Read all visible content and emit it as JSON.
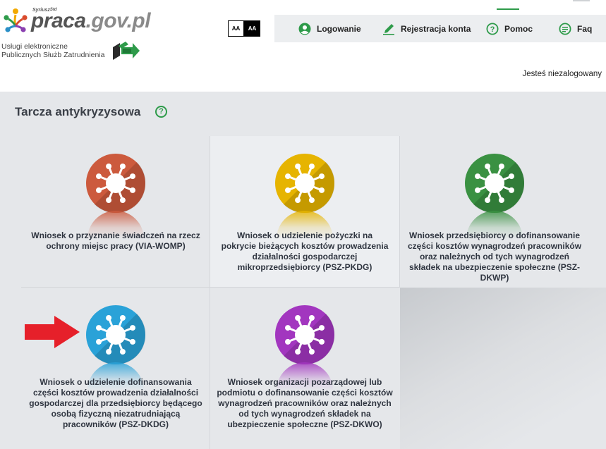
{
  "header": {
    "logo_main": "praca",
    "logo_domain": ".gov.pl",
    "logo_small": "Syriusz",
    "logo_small_sup": "Std",
    "subtitle_line1": "Usługi elektroniczne",
    "subtitle_line2": "Publicznych Służb Zatrudnienia",
    "font_small": "AA",
    "font_contrast": "AA",
    "login_status": "Jesteś niezalogowany"
  },
  "nav": {
    "login": "Logowanie",
    "register": "Rejestracja konta",
    "help": "Pomoc",
    "faq": "Faq"
  },
  "section": {
    "title": "Tarcza antykryzysowa",
    "help_glyph": "?"
  },
  "cards": [
    {
      "label": "Wniosek o przyznanie świadczeń na rzecz ochrony miejsc pracy (VIA-WOMP)",
      "color": "#cc5a3d",
      "icon": "virus-icon"
    },
    {
      "label": "Wniosek o udzielenie pożyczki na pokrycie bieżących kosztów prowadzenia działalności gospodarczej mikroprzedsiębiorcy (PSZ-PKDG)",
      "color": "#e6b400",
      "icon": "virus-icon"
    },
    {
      "label": "Wniosek przedsiębiorcy o dofinansowanie części kosztów wynagrodzeń pracowników oraz należnych od tych wynagrodzeń składek na ubezpieczenie społeczne (PSZ-DKWP)",
      "color": "#3a9142",
      "icon": "virus-icon"
    },
    {
      "label": "Wniosek o udzielenie dofinansowania części kosztów prowadzenia działalności gospodarczej dla przedsiębiorcy będącego osobą fizyczną niezatrudniającą pracowników (PSZ-DKDG)",
      "color": "#2aa2d8",
      "icon": "virus-icon"
    },
    {
      "label": "Wniosek organizacji pozarządowej lub podmiotu o dofinansowanie części kosztów wynagrodzeń pracowników oraz należnych od tych wynagrodzeń składek na ubezpieczenie społeczne (PSZ-DKWO)",
      "color": "#a236bf",
      "icon": "virus-icon"
    }
  ],
  "colors": {
    "accent": "#2e9b4a",
    "content_bg": "#e5e7ea",
    "arrow": "#e6202a"
  }
}
